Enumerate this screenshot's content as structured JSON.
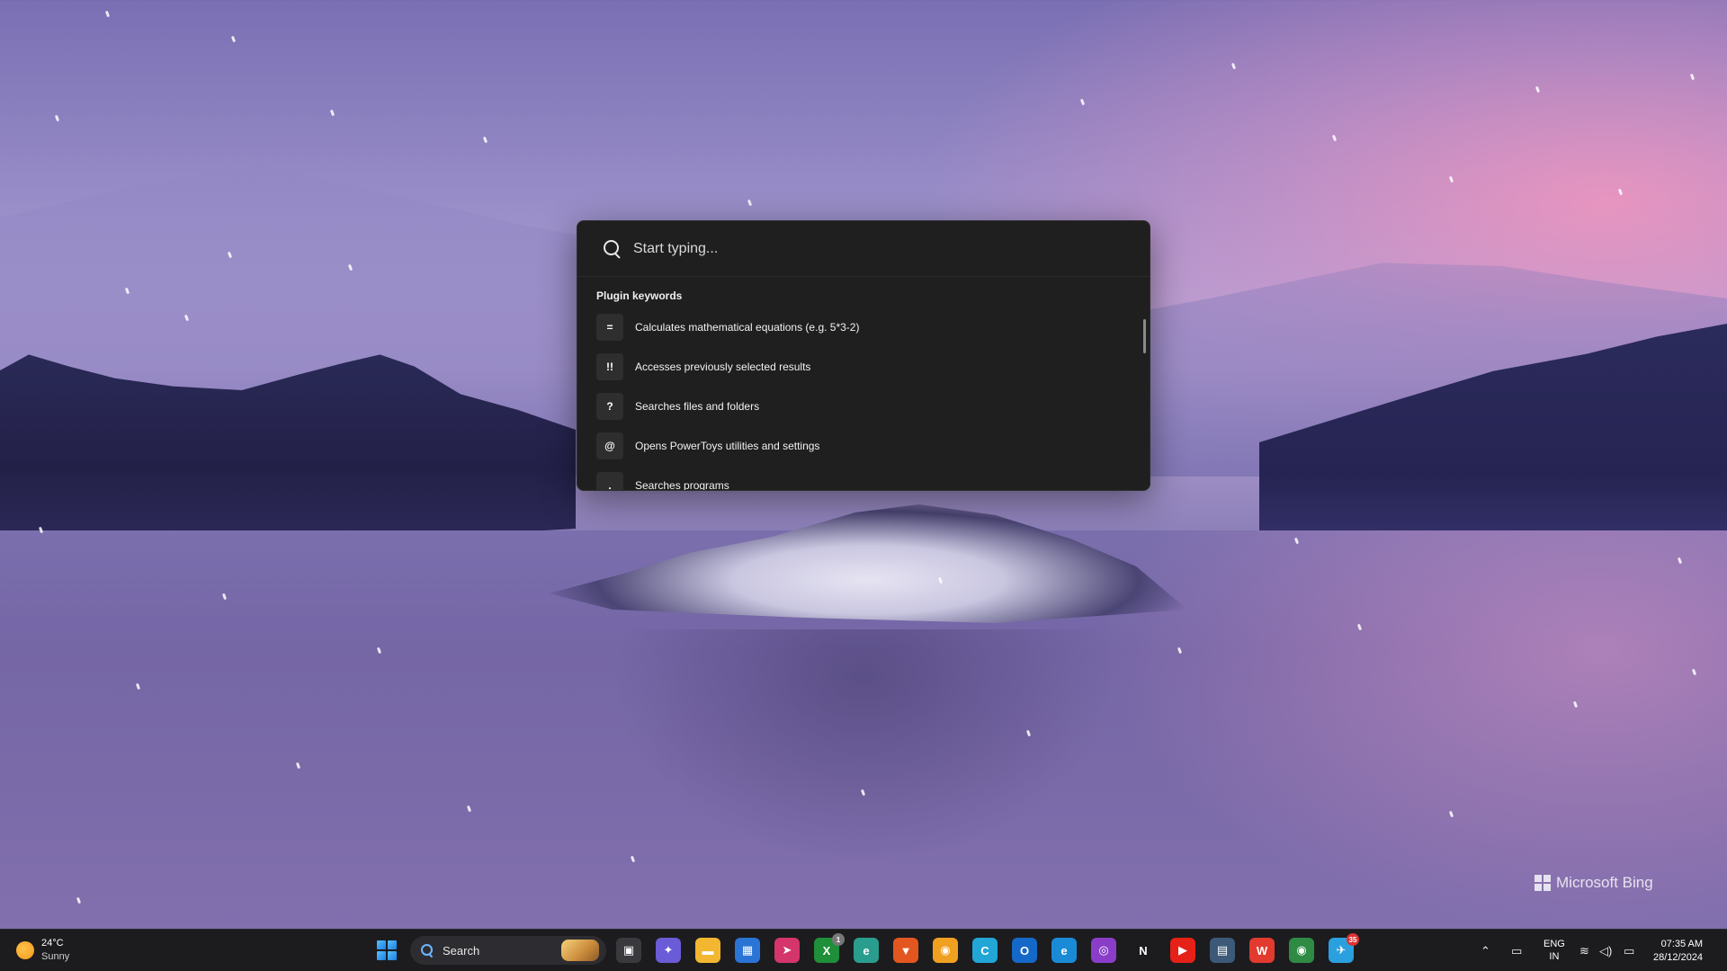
{
  "launcher": {
    "search_placeholder": "Start typing...",
    "section_title": "Plugin keywords",
    "results": [
      {
        "key": "=",
        "text": "Calculates mathematical equations (e.g. 5*3-2)"
      },
      {
        "key": "!!",
        "text": "Accesses previously selected results"
      },
      {
        "key": "?",
        "text": "Searches files and folders"
      },
      {
        "key": "@",
        "text": "Opens PowerToys utilities and settings"
      },
      {
        "key": ".",
        "text": "Searches programs"
      }
    ]
  },
  "wallpaper": {
    "watermark": "Microsoft Bing"
  },
  "taskbar": {
    "weather": {
      "temp": "24°C",
      "condition": "Sunny"
    },
    "search_label": "Search",
    "apps": [
      {
        "name": "task-view",
        "color": "#3a3a3e",
        "glyph": "▣"
      },
      {
        "name": "copilot",
        "color": "#6a5bd6",
        "glyph": "✦"
      },
      {
        "name": "file-explorer",
        "color": "#f2b630",
        "glyph": "▬"
      },
      {
        "name": "microsoft-store",
        "color": "#2a74d6",
        "glyph": "▦"
      },
      {
        "name": "app-pink",
        "color": "#d4356b",
        "glyph": "➤"
      },
      {
        "name": "xbox",
        "color": "#1f8f3a",
        "glyph": "X",
        "badge": "1"
      },
      {
        "name": "edge-dev",
        "color": "#2a9e8e",
        "glyph": "e"
      },
      {
        "name": "brave",
        "color": "#e4561f",
        "glyph": "▼"
      },
      {
        "name": "chrome-canary",
        "color": "#f0a020",
        "glyph": "◉"
      },
      {
        "name": "app-c",
        "color": "#21a6d6",
        "glyph": "C"
      },
      {
        "name": "outlook",
        "color": "#1468c8",
        "glyph": "O"
      },
      {
        "name": "edge",
        "color": "#1a8ad6",
        "glyph": "e"
      },
      {
        "name": "app-purple",
        "color": "#8a3ec8",
        "glyph": "◎"
      },
      {
        "name": "netflix",
        "color": "#1c1c1f",
        "glyph": "N"
      },
      {
        "name": "youtube",
        "color": "#e62117",
        "glyph": "▶"
      },
      {
        "name": "app-window",
        "color": "#3c5a78",
        "glyph": "▤"
      },
      {
        "name": "wps-office",
        "color": "#e23a2e",
        "glyph": "W"
      },
      {
        "name": "chrome",
        "color": "#2f8a44",
        "glyph": "◉"
      },
      {
        "name": "telegram",
        "color": "#2aa0de",
        "glyph": "✈",
        "badge": "35"
      }
    ],
    "tray": {
      "lang_top": "ENG",
      "lang_bottom": "IN",
      "time": "07:35 AM",
      "date": "28/12/2024"
    }
  }
}
